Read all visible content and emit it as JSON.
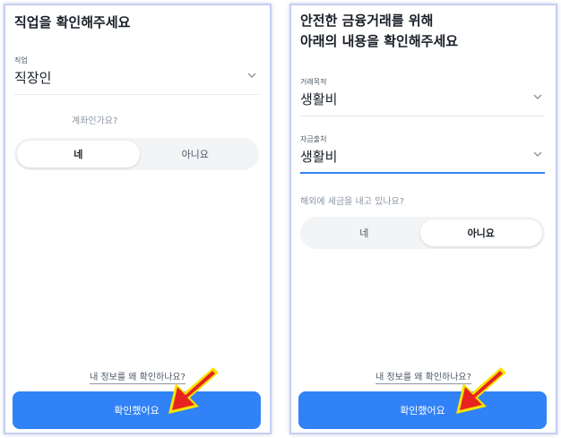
{
  "left": {
    "title": "직업을 확인해주세요",
    "job_label": "직업",
    "job_value": "직장인",
    "question": "계좌인가요?",
    "options": [
      "네",
      "아니요"
    ],
    "selected": "네",
    "info_link": "내 정보를 왜 확인하나요?",
    "confirm": "확인했어요"
  },
  "right": {
    "title_line1": "안전한 금융거래를 위해",
    "title_line2": "아래의 내용을 확인해주세요",
    "purpose_label": "거래목적",
    "purpose_value": "생활비",
    "source_label": "자금출처",
    "source_value": "생활비",
    "question": "해외에 세금을 내고 있나요?",
    "options": [
      "네",
      "아니요"
    ],
    "selected": "아니요",
    "info_link": "내 정보를 왜 확인하나요?",
    "confirm": "확인했어요"
  },
  "colors": {
    "accent": "#3182f6",
    "arrow_fill": "#e8231f",
    "arrow_outline": "#f5e400"
  },
  "icons": [
    "chevron-down-icon",
    "red-pointer-arrow-icon"
  ]
}
